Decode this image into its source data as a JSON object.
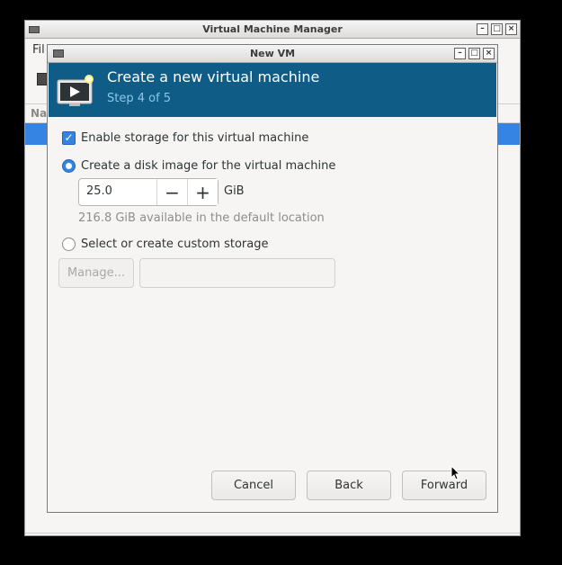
{
  "main_window": {
    "title": "Virtual Machine Manager",
    "menu_first": "Fil",
    "column_header": "Na"
  },
  "dialog": {
    "title": "New VM",
    "banner_title": "Create a new virtual machine",
    "banner_step": "Step 4 of 5",
    "enable_storage_label": "Enable storage for this virtual machine",
    "enable_storage_checked": true,
    "create_disk_label": "Create a disk image for the virtual machine",
    "disk_size_value": "25.0",
    "disk_unit": "GiB",
    "available_text": "216.8 GiB available in the default location",
    "custom_storage_label": "Select or create custom storage",
    "manage_label": "Manage...",
    "custom_path_value": "",
    "cancel_label": "Cancel",
    "back_label": "Back",
    "forward_label": "Forward"
  },
  "window_buttons": {
    "minimize": "–",
    "maximize": "□",
    "close": "×"
  },
  "colors": {
    "banner": "#0f5c87",
    "accent": "#3584e4",
    "banner_subtitle": "#8ec5ea"
  }
}
